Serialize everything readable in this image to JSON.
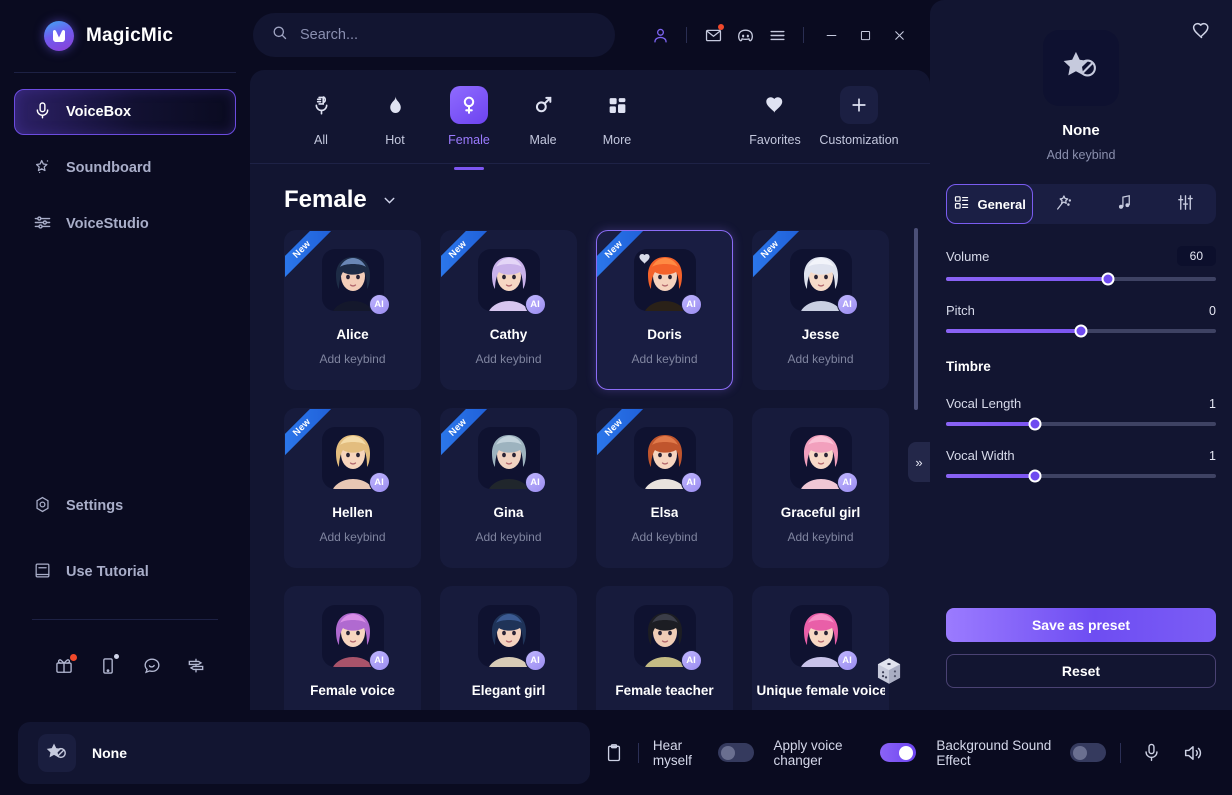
{
  "app": {
    "title": "MagicMic"
  },
  "sidebar": {
    "items": [
      {
        "label": "VoiceBox",
        "icon": "microphone-icon",
        "active": true
      },
      {
        "label": "Soundboard",
        "icon": "magic-star-icon",
        "active": false
      },
      {
        "label": "VoiceStudio",
        "icon": "sliders-icon",
        "active": false
      }
    ],
    "bottom_items": [
      {
        "label": "Settings",
        "icon": "gear-icon"
      },
      {
        "label": "Use Tutorial",
        "icon": "book-icon"
      }
    ],
    "footer_icons": [
      {
        "name": "gift-box-icon",
        "badge": "red"
      },
      {
        "name": "mobile-device-icon",
        "badge": "grey"
      },
      {
        "name": "chat-bubble-icon",
        "badge": ""
      },
      {
        "name": "feedback-icon",
        "badge": ""
      }
    ]
  },
  "search": {
    "placeholder": "Search...",
    "value": "",
    "icon": "search-icon"
  },
  "titlebar": {
    "icons": [
      {
        "name": "user-account-icon"
      },
      {
        "name": "mail-icon"
      },
      {
        "name": "discord-icon"
      },
      {
        "name": "hamburger-menu-icon"
      }
    ],
    "window_controls": [
      {
        "name": "minimize-button",
        "glyph": "–"
      },
      {
        "name": "maximize-button",
        "glyph": "□"
      },
      {
        "name": "close-button",
        "glyph": "✕"
      }
    ]
  },
  "categories": [
    {
      "label": "All",
      "icon": "microphone-all-icon",
      "active": false
    },
    {
      "label": "Hot",
      "icon": "flame-icon",
      "active": false
    },
    {
      "label": "Female",
      "icon": "female-symbol-icon",
      "active": true
    },
    {
      "label": "Male",
      "icon": "male-symbol-icon",
      "active": false
    },
    {
      "label": "More",
      "icon": "grid-blocks-icon",
      "active": false
    }
  ],
  "categories_right": [
    {
      "label": "Favorites",
      "icon": "heart-icon"
    },
    {
      "label": "Customization",
      "icon": "plus-icon"
    }
  ],
  "grid": {
    "title": "Female",
    "dropdown_icon": "chevron-down-icon",
    "keybind_label": "Add keybind",
    "new_badge": "New",
    "ai_badge": "AI",
    "collapse_icon": "»",
    "dice_icon": "random-dice-icon",
    "cards": [
      {
        "name": "Alice",
        "new": true,
        "selected": false,
        "favorite": false,
        "hair": "#1d2b45",
        "hair2": "#6a87b5",
        "skin": "#f3cdb8",
        "cloth": "#14182c"
      },
      {
        "name": "Cathy",
        "new": true,
        "selected": false,
        "favorite": false,
        "hair": "#c9b2ea",
        "hair2": "#e4d6f7",
        "skin": "#f6d7c3",
        "cloth": "#d7c6ef"
      },
      {
        "name": "Doris",
        "new": true,
        "selected": true,
        "favorite": true,
        "hair": "#f4622a",
        "hair2": "#ff8a43",
        "skin": "#f5d2bd",
        "cloth": "#2a2118"
      },
      {
        "name": "Jesse",
        "new": true,
        "selected": false,
        "favorite": false,
        "hair": "#dfe3ef",
        "hair2": "#f2f4fa",
        "skin": "#f6dbc9",
        "cloth": "#c9cfe2"
      },
      {
        "name": "Hellen",
        "new": true,
        "selected": false,
        "favorite": false,
        "hair": "#e3bd7e",
        "hair2": "#f4dba8",
        "skin": "#f7d5bc",
        "cloth": "#e8c7b4"
      },
      {
        "name": "Gina",
        "new": true,
        "selected": false,
        "favorite": false,
        "hair": "#9db3bf",
        "hair2": "#c3d3dc",
        "skin": "#f0d3c2",
        "cloth": "#20262c"
      },
      {
        "name": "Elsa",
        "new": true,
        "selected": false,
        "favorite": false,
        "hair": "#c0552d",
        "hair2": "#e0794a",
        "skin": "#f6d5c0",
        "cloth": "#e9e2de"
      },
      {
        "name": "Graceful girl",
        "new": false,
        "selected": false,
        "favorite": false,
        "hair": "#f2a0bd",
        "hair2": "#fbc2d6",
        "skin": "#f8dac9",
        "cloth": "#efc7d5"
      },
      {
        "name": "Female voice",
        "new": false,
        "selected": false,
        "favorite": false,
        "hair": "#b06ad0",
        "hair2": "#d98fe8",
        "skin": "#f7d5c0",
        "cloth": "#a8536a"
      },
      {
        "name": "Elegant girl",
        "new": false,
        "selected": false,
        "favorite": false,
        "hair": "#1f3358",
        "hair2": "#3b5a92",
        "skin": "#f4d3bf",
        "cloth": "#d8cbb6"
      },
      {
        "name": "Female teacher",
        "new": false,
        "selected": false,
        "favorite": false,
        "hair": "#1c1d23",
        "hair2": "#3b3d48",
        "skin": "#f0cdb6",
        "cloth": "#c4bb84"
      },
      {
        "name": "Unique female voice",
        "new": false,
        "selected": false,
        "favorite": false,
        "hair": "#e95fa8",
        "hair2": "#f78fc6",
        "skin": "#f8d8c5",
        "cloth": "#c9c3ea"
      }
    ]
  },
  "right_panel": {
    "voice_name": "None",
    "keybind_label": "Add keybind",
    "favorite_icon": "heart-outline-icon",
    "thumb_icon": "star-none-icon",
    "tabs": [
      {
        "label": "General",
        "icon": "grid-icon",
        "active": true
      },
      {
        "label": "",
        "icon": "magic-wand-icon",
        "active": false
      },
      {
        "label": "",
        "icon": "music-note-icon",
        "active": false
      },
      {
        "label": "",
        "icon": "equalizer-icon",
        "active": false
      }
    ],
    "sliders": [
      {
        "label": "Volume",
        "value": "60",
        "percent": 60,
        "boxed": true
      },
      {
        "label": "Pitch",
        "value": "0",
        "percent": 50,
        "boxed": false
      }
    ],
    "timbre_title": "Timbre",
    "timbre_sliders": [
      {
        "label": "Vocal Length",
        "value": "1",
        "percent": 33,
        "boxed": false
      },
      {
        "label": "Vocal Width",
        "value": "1",
        "percent": 33,
        "boxed": false
      }
    ],
    "save_label": "Save as preset",
    "reset_label": "Reset"
  },
  "bottom_bar": {
    "voice_name": "None",
    "thumb_icon": "star-none-icon",
    "clipboard_icon": "clipboard-icon",
    "toggles": [
      {
        "label": "Hear myself",
        "on": false
      },
      {
        "label": "Apply voice changer",
        "on": true
      },
      {
        "label": "Background Sound Effect",
        "on": false
      }
    ],
    "tail_icons": [
      {
        "name": "microphone-icon"
      },
      {
        "name": "speaker-icon"
      }
    ]
  },
  "colors": {
    "accent": "#7b55f0",
    "accent_light": "#9b7bff",
    "panel": "#121531",
    "app_bg": "#0a0b20",
    "card": "#171b3c",
    "badge_blue": "#2f7ef0",
    "alert_red": "#f1492b"
  }
}
